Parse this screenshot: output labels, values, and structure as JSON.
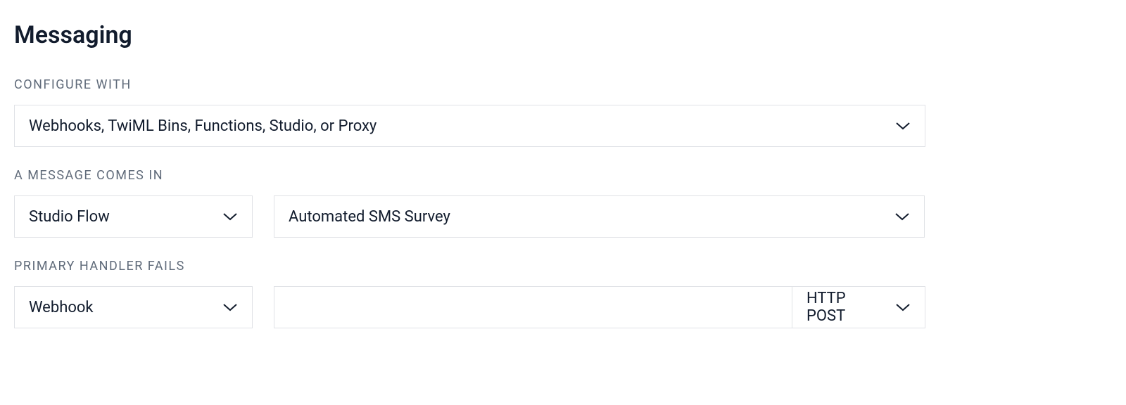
{
  "section": {
    "title": "Messaging"
  },
  "configure_with": {
    "label": "Configure with",
    "value": "Webhooks, TwiML Bins, Functions, Studio, or Proxy"
  },
  "message_comes_in": {
    "label": "A message comes in",
    "handler_type": "Studio Flow",
    "handler_value": "Automated SMS Survey"
  },
  "primary_handler_fails": {
    "label": "Primary handler fails",
    "handler_type": "Webhook",
    "url_value": "",
    "http_method": "HTTP POST"
  }
}
